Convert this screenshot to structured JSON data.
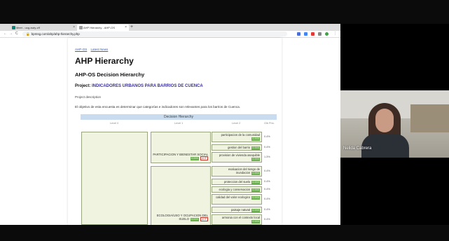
{
  "browser": {
    "tabs": [
      {
        "title": "Meet - uog-swiy-zff",
        "favicon_color": "#00897b"
      },
      {
        "title": "AHP Hierarchy - AHP-OS",
        "favicon_color": "#9e9e9e"
      }
    ],
    "new_tab": "+",
    "url": "bpmsg.com/ahp/ahp-hierarchy.php",
    "nav": {
      "back": "←",
      "forward": "→",
      "reload": "C"
    }
  },
  "page": {
    "links": [
      "AHP-OS",
      "Latest News"
    ],
    "title": "AHP Hierarchy",
    "subtitle": "AHP-OS Decision Hierarchy",
    "project_label": "Project:",
    "project_name": "INDICADORES URBANOS PARA BARRIOS DE CUENCA",
    "description_label": "Project description",
    "description": "El objetivo de esta encuesta es determinar que categorías e indicadores son relevantes para los barrios de Cuenca.",
    "hierarchy": {
      "title": "Decision Hierarchy",
      "columns": [
        "Level 0",
        "Level 1",
        "Level 2",
        "Glb Prio."
      ],
      "level1": [
        {
          "label": "PARTICIPACION Y BIENESTAR SOCIAL",
          "weight": "0.XXX",
          "tag": "AHP"
        },
        {
          "label": "ECOLOGIA/USO Y OCUPACION DEL SUELO",
          "weight": "0.XXX",
          "tag": "AHP"
        }
      ],
      "level2": [
        {
          "label": "participacion de la comunidad",
          "weight": "0.XXX",
          "prio": "0.4%"
        },
        {
          "label": "gestion del barrio",
          "weight": "0.XXX",
          "prio": "0.4%"
        },
        {
          "label": "provision de vivienda asequible",
          "weight": "0.XXX",
          "prio": "1.3%"
        },
        {
          "label": "evaluacion del riesgo de inundacion",
          "weight": "0.XXX",
          "prio": "0.4%"
        },
        {
          "label": "proteccion del suelo",
          "weight": "0.XXX",
          "prio": "0.4%"
        },
        {
          "label": "ecologia y conservacion",
          "weight": "0.XXX",
          "prio": "0.4%"
        },
        {
          "label": "calidad del valor ecologico",
          "weight": "0.XXX",
          "prio": "0.4%"
        },
        {
          "label": "paisaje natural",
          "weight": "0.XXX",
          "prio": "0.4%"
        },
        {
          "label": "armonia con el contexto local",
          "weight": "0.XXX",
          "prio": "0.4%"
        }
      ]
    }
  },
  "video": {
    "participant_name": "Nelida Cabrera"
  }
}
